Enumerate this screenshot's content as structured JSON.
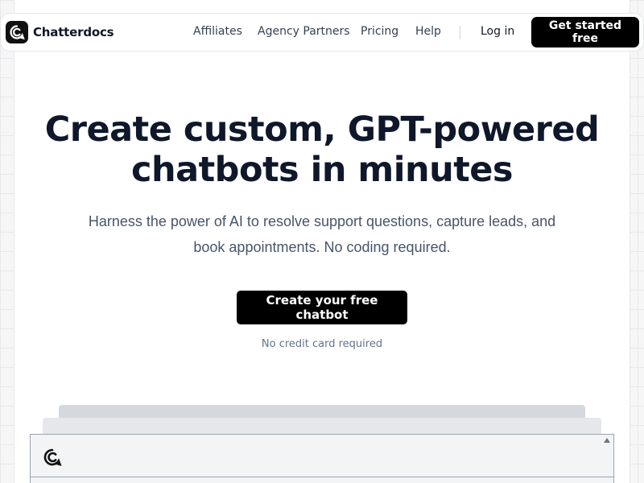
{
  "nav": {
    "brand": "Chatterdocs",
    "links": [
      {
        "label": "Affiliates"
      },
      {
        "label": "Agency Partners"
      },
      {
        "label": "Pricing"
      },
      {
        "label": "Help"
      }
    ],
    "login": "Log in",
    "cta": "Get started free"
  },
  "hero": {
    "title_line1": "Create custom, GPT-powered",
    "title_line2": "chatbots in minutes",
    "subtitle_line1": "Harness the power of AI to resolve support questions, capture leads, and",
    "subtitle_line2": "book appointments. No coding required.",
    "cta": "Create your free chatbot",
    "note": "No credit card required"
  },
  "icons": {
    "brand_logo": "chat-bubble-logo-icon",
    "preview_logo": "chat-bubble-logo-icon",
    "scroll_up": "scroll-up-arrow-icon"
  },
  "colors": {
    "primary": "#000000",
    "text": "#0f172a",
    "muted": "#475569"
  }
}
